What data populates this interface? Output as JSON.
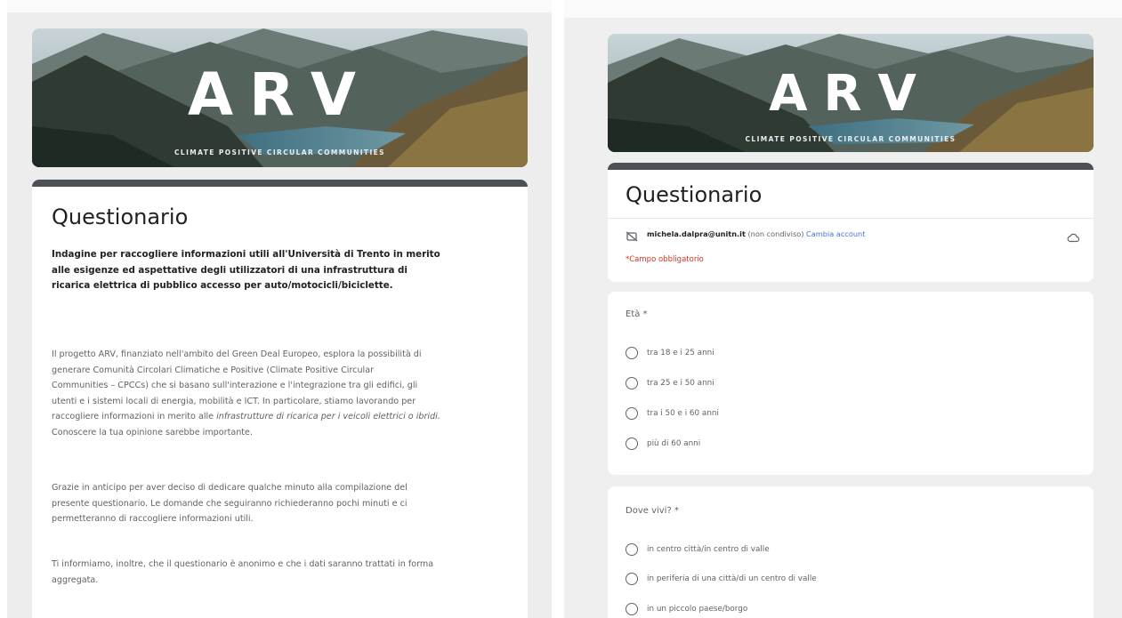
{
  "brand": {
    "logo": "ARV",
    "tagline": "CLIMATE POSITIVE CIRCULAR COMMUNITIES"
  },
  "left": {
    "title": "Questionario",
    "subtitle_lines": [
      "Indagine per raccogliere informazioni utili all'Università di Trento in merito",
      "alle esigenze ed aspettative degli utilizzatori di una infrastruttura di",
      "ricarica elettrica di pubblico accesso per auto/motocicli/biciclette."
    ],
    "p1_lines": [
      "Il progetto ARV, finanziato nell'ambito del Green Deal Europeo, esplora la possibilità di",
      "generare Comunità Circolari Climatiche e Positive (Climate Positive Circular",
      "Communities – CPCCs) che si basano sull'interazione e l'integrazione tra gli edifici, gli",
      "utenti e i sistemi locali di energia, mobilità e ICT. In particolare, stiamo lavorando per"
    ],
    "p1_line5_normal": "raccogliere informazioni in merito alle ",
    "p1_line5_italic": "infrastrutture di ricarica per i veicoli elettrici o ibridi.",
    "p1_line6": "Conoscere la tua opinione sarebbe importante.",
    "p2_lines": [
      "Grazie in anticipo per aver deciso di dedicare qualche minuto alla compilazione del",
      "presente questionario. Le domande che seguiranno richiederanno pochi minuti e ci",
      "permetteranno di raccogliere informazioni utili."
    ],
    "p3_lines": [
      "Ti informiamo, inoltre, che il questionario è anonimo e che i dati saranno trattati in forma",
      "aggregata."
    ]
  },
  "right": {
    "title": "Questionario",
    "account_email": "michela.dalpra@unitn.it",
    "account_note": "(non condiviso)",
    "switch_account": "Cambia account",
    "required_note": "*Campo obbligatorio",
    "q1": {
      "label": "Età *",
      "options": [
        "tra 18 e i 25 anni",
        "tra 25 e i 50 anni",
        "tra i 50 e i 60 anni",
        "più di 60 anni"
      ]
    },
    "q2": {
      "label": "Dove vivi? *",
      "options": [
        "in centro città/in centro di valle",
        "in periferia di una città/di un centro di valle",
        "in un piccolo paese/borgo"
      ]
    }
  }
}
